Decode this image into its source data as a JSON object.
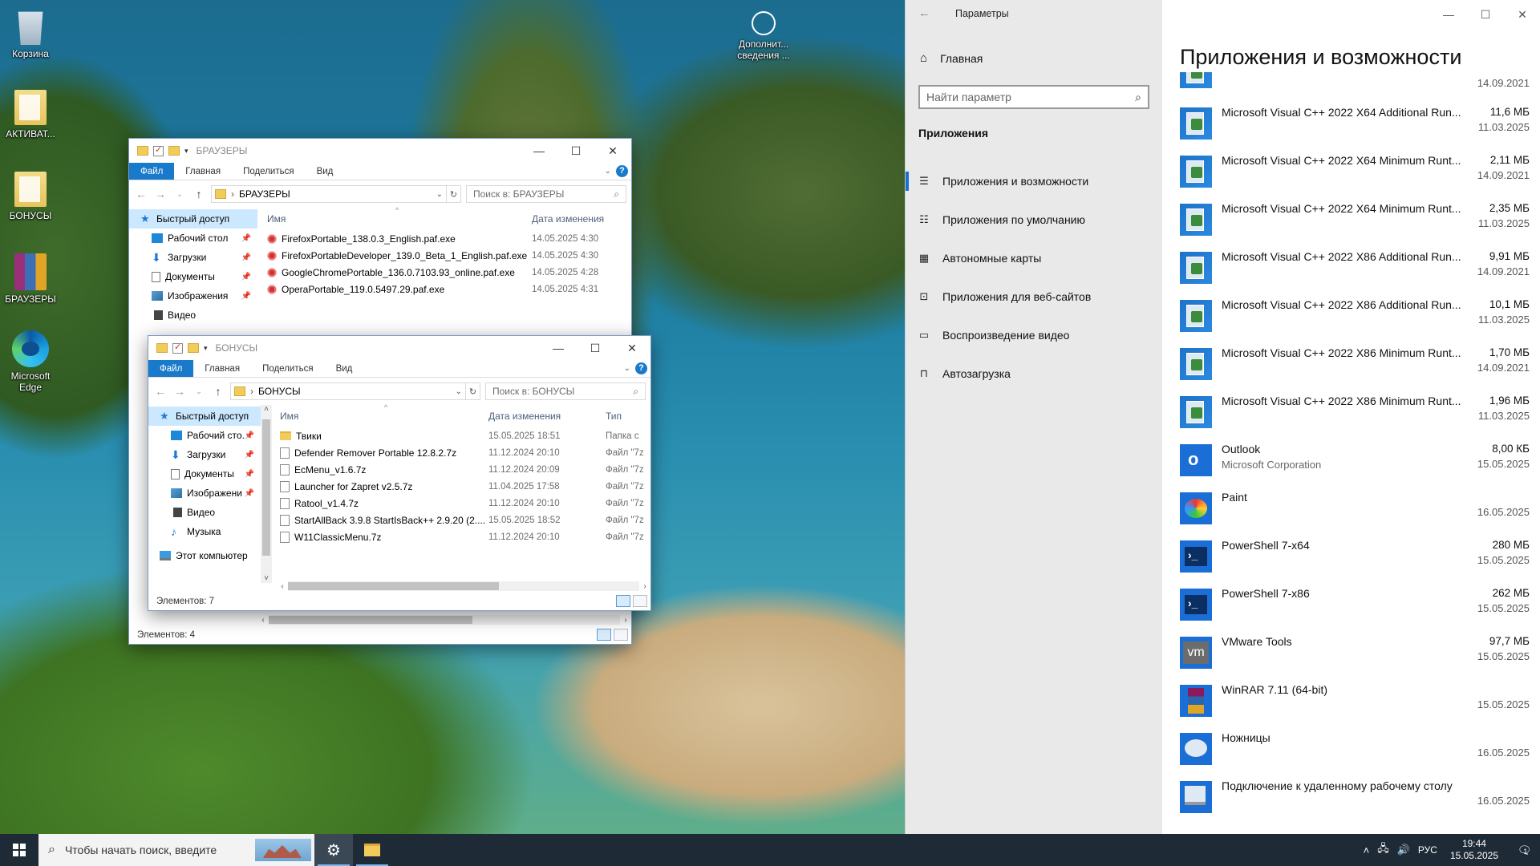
{
  "desktop": {
    "icons": [
      {
        "label": "Корзина",
        "icon": "recycle-bin-icon"
      },
      {
        "label": "АКТИВАТ...",
        "icon": "folder-icon"
      },
      {
        "label": "БОНУСЫ",
        "icon": "folder-icon"
      },
      {
        "label": "БРАУЗЕРЫ",
        "icon": "archive-icon"
      },
      {
        "label": "Microsoft Edge",
        "icon": "edge-icon"
      }
    ],
    "extra_icon": {
      "label": "Дополнит... сведения ...",
      "icon": "info-icon"
    }
  },
  "explorer_browsers": {
    "title": "БРАУЗЕРЫ",
    "ribbon": [
      "Файл",
      "Главная",
      "Поделиться",
      "Вид"
    ],
    "address": "БРАУЗЕРЫ",
    "search_placeholder": "Поиск в: БРАУЗЕРЫ",
    "columns": {
      "name": "Имя",
      "date": "Дата изменения"
    },
    "nav": [
      {
        "label": "Быстрый доступ",
        "icon": "star-icon",
        "pinned": false
      },
      {
        "label": "Рабочий стол",
        "icon": "desktop-icon",
        "pinned": true
      },
      {
        "label": "Загрузки",
        "icon": "downloads-icon",
        "pinned": true
      },
      {
        "label": "Документы",
        "icon": "documents-icon",
        "pinned": true
      },
      {
        "label": "Изображения",
        "icon": "pictures-icon",
        "pinned": true
      },
      {
        "label": "Видео",
        "icon": "videos-icon",
        "pinned": false
      }
    ],
    "files": [
      {
        "name": "FirefoxPortable_138.0.3_English.paf.exe",
        "date": "14.05.2025 4:30"
      },
      {
        "name": "FirefoxPortableDeveloper_139.0_Beta_1_English.paf.exe",
        "date": "14.05.2025 4:30"
      },
      {
        "name": "GoogleChromePortable_136.0.7103.93_online.paf.exe",
        "date": "14.05.2025 4:28"
      },
      {
        "name": "OperaPortable_119.0.5497.29.paf.exe",
        "date": "14.05.2025 4:31"
      }
    ],
    "status": "Элементов: 4"
  },
  "explorer_bonus": {
    "title": "БОНУСЫ",
    "ribbon": [
      "Файл",
      "Главная",
      "Поделиться",
      "Вид"
    ],
    "address": "БОНУСЫ",
    "search_placeholder": "Поиск в: БОНУСЫ",
    "columns": {
      "name": "Имя",
      "date": "Дата изменения",
      "type": "Тип"
    },
    "nav": [
      {
        "label": "Быстрый доступ",
        "icon": "star-icon",
        "pinned": false
      },
      {
        "label": "Рабочий сто.",
        "icon": "desktop-icon",
        "pinned": true
      },
      {
        "label": "Загрузки",
        "icon": "downloads-icon",
        "pinned": true
      },
      {
        "label": "Документы",
        "icon": "documents-icon",
        "pinned": true
      },
      {
        "label": "Изображени",
        "icon": "pictures-icon",
        "pinned": true
      },
      {
        "label": "Видео",
        "icon": "videos-icon",
        "pinned": false
      },
      {
        "label": "Музыка",
        "icon": "music-icon",
        "pinned": false
      },
      {
        "label": "Этот компьютер",
        "icon": "computer-icon",
        "pinned": false
      }
    ],
    "files": [
      {
        "name": "Твики",
        "date": "15.05.2025 18:51",
        "type": "Папка с",
        "kind": "folder"
      },
      {
        "name": "Defender Remover Portable 12.8.2.7z",
        "date": "11.12.2024 20:10",
        "type": "Файл \"7z",
        "kind": "file"
      },
      {
        "name": "EcMenu_v1.6.7z",
        "date": "11.12.2024 20:09",
        "type": "Файл \"7z",
        "kind": "file"
      },
      {
        "name": "Launcher for Zapret v2.5.7z",
        "date": "11.04.2025 17:58",
        "type": "Файл \"7z",
        "kind": "file"
      },
      {
        "name": "Ratool_v1.4.7z",
        "date": "11.12.2024 20:10",
        "type": "Файл \"7z",
        "kind": "file"
      },
      {
        "name": "StartAllBack 3.9.8 StartIsBack++ 2.9.20 (2....",
        "date": "15.05.2025 18:52",
        "type": "Файл \"7z",
        "kind": "file"
      },
      {
        "name": "W11ClassicMenu.7z",
        "date": "11.12.2024 20:10",
        "type": "Файл \"7z",
        "kind": "file"
      }
    ],
    "status": "Элементов: 7"
  },
  "settings": {
    "window_title": "Параметры",
    "home": "Главная",
    "search_placeholder": "Найти параметр",
    "section": "Приложения",
    "nav": [
      {
        "label": "Приложения и возможности",
        "icon": "list-icon",
        "selected": true
      },
      {
        "label": "Приложения по умолчанию",
        "icon": "default-apps-icon",
        "selected": false
      },
      {
        "label": "Автономные карты",
        "icon": "map-icon",
        "selected": false
      },
      {
        "label": "Приложения для веб-сайтов",
        "icon": "website-icon",
        "selected": false
      },
      {
        "label": "Воспроизведение видео",
        "icon": "video-icon",
        "selected": false
      },
      {
        "label": "Автозагрузка",
        "icon": "startup-icon",
        "selected": false
      }
    ],
    "heading": "Приложения и возможности",
    "partial_top_date": "14.09.2021",
    "apps": [
      {
        "name": "Microsoft Visual C++ 2022 X64 Additional Run...",
        "publisher": "",
        "size": "11,6 МБ",
        "date": "11.03.2025",
        "icon": "vc-icon"
      },
      {
        "name": "Microsoft Visual C++ 2022 X64 Minimum Runt...",
        "publisher": "",
        "size": "2,11 МБ",
        "date": "14.09.2021",
        "icon": "vc-icon"
      },
      {
        "name": "Microsoft Visual C++ 2022 X64 Minimum Runt...",
        "publisher": "",
        "size": "2,35 МБ",
        "date": "11.03.2025",
        "icon": "vc-icon"
      },
      {
        "name": "Microsoft Visual C++ 2022 X86 Additional Run...",
        "publisher": "",
        "size": "9,91 МБ",
        "date": "14.09.2021",
        "icon": "vc-icon"
      },
      {
        "name": "Microsoft Visual C++ 2022 X86 Additional Run...",
        "publisher": "",
        "size": "10,1 МБ",
        "date": "11.03.2025",
        "icon": "vc-icon"
      },
      {
        "name": "Microsoft Visual C++ 2022 X86 Minimum Runt...",
        "publisher": "",
        "size": "1,70 МБ",
        "date": "14.09.2021",
        "icon": "vc-icon"
      },
      {
        "name": "Microsoft Visual C++ 2022 X86 Minimum Runt...",
        "publisher": "",
        "size": "1,96 МБ",
        "date": "11.03.2025",
        "icon": "vc-icon"
      },
      {
        "name": "Outlook",
        "publisher": "Microsoft Corporation",
        "size": "8,00 КБ",
        "date": "15.05.2025",
        "icon": "outlook-icon"
      },
      {
        "name": "Paint",
        "publisher": "",
        "size": "",
        "date": "16.05.2025",
        "icon": "paint-icon"
      },
      {
        "name": "PowerShell 7-x64",
        "publisher": "",
        "size": "280 МБ",
        "date": "15.05.2025",
        "icon": "powershell-icon"
      },
      {
        "name": "PowerShell 7-x86",
        "publisher": "",
        "size": "262 МБ",
        "date": "15.05.2025",
        "icon": "powershell-icon"
      },
      {
        "name": "VMware Tools",
        "publisher": "",
        "size": "97,7 МБ",
        "date": "15.05.2025",
        "icon": "vmware-icon"
      },
      {
        "name": "WinRAR 7.11 (64-bit)",
        "publisher": "",
        "size": "",
        "date": "15.05.2025",
        "icon": "winrar-icon"
      },
      {
        "name": "Ножницы",
        "publisher": "",
        "size": "",
        "date": "16.05.2025",
        "icon": "snipping-icon"
      },
      {
        "name": "Подключение к удаленному рабочему столу",
        "publisher": "",
        "size": "",
        "date": "16.05.2025",
        "icon": "remote-desktop-icon"
      }
    ]
  },
  "taskbar": {
    "search_placeholder": "Чтобы начать поиск, введите",
    "lang": "РУС",
    "time": "19:44",
    "date": "15.05.2025",
    "notifications": "1"
  }
}
